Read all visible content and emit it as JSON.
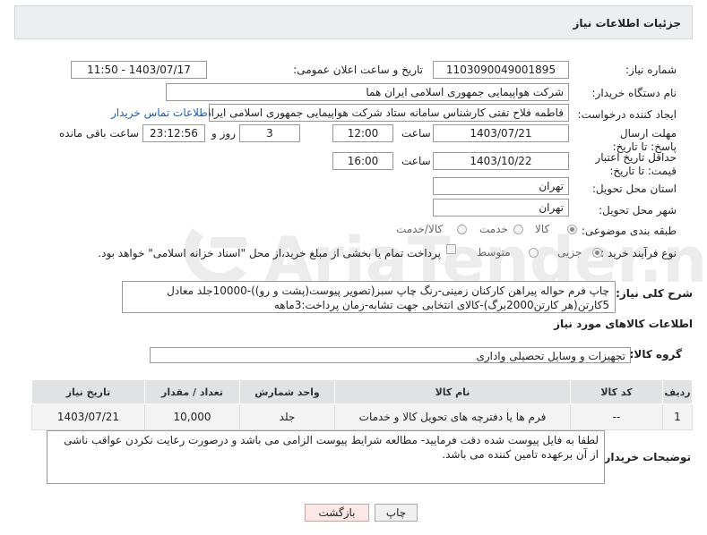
{
  "header": {
    "title": "جزئیات اطلاعات نیاز"
  },
  "form": {
    "need_number": {
      "label": "شماره نیاز:",
      "value": "1103090049001895"
    },
    "announce": {
      "label": "تاریخ و ساعت اعلان عمومی:",
      "value": "1403/07/17 - 11:50"
    },
    "buyer_org": {
      "label": "نام دستگاه خریدار:",
      "value": "شرکت هواپیمایی جمهوری اسلامی ایران هما"
    },
    "creator": {
      "label": "ایجاد کننده درخواست:",
      "value": "فاطمه فلاح تفتی کارشناس سامانه ستاد شرکت هواپیمایی جمهوری اسلامی ایران هما",
      "contact_link": "اطلاعات تماس خریدار"
    },
    "reply_deadline": {
      "label": "مهلت ارسال پاسخ: تا تاریخ:",
      "date": "1403/07/21",
      "time_label": "ساعت",
      "time": "12:00",
      "days": "3",
      "days_label": "روز و",
      "remaining": "23:12:56",
      "remaining_label": "ساعت باقی مانده"
    },
    "price_validity": {
      "label": "حداقل تاریخ اعتبار قیمت: تا تاریخ:",
      "date": "1403/10/22",
      "time_label": "ساعت",
      "time": "16:00"
    },
    "province": {
      "label": "استان محل تحویل:",
      "value": "تهران"
    },
    "city": {
      "label": "شهر محل تحویل:",
      "value": "تهران"
    },
    "category": {
      "label": "طبقه بندی موضوعی:",
      "options": [
        "کالا",
        "خدمت",
        "کالا/خدمت"
      ],
      "selected": 0
    },
    "process": {
      "label": "نوع فرآیند خرید :",
      "options": [
        "جزیی",
        "متوسط"
      ],
      "selected": 0,
      "note": "پرداخت تمام یا بخشی از مبلغ خرید،از محل \"اسناد خزانه اسلامی\" خواهد بود."
    }
  },
  "description": {
    "label": "شرح کلی نیاز:",
    "text": "چاپ فرم حواله پیراهن کارکنان زمینی-رنگ چاپ سبز(تصویر پیوست(پشت و رو))-10000جلد معادل 5کارتن(هر کارتن2000برگ)-کالای انتخابی جهت تشابه-زمان پرداخت:3ماهه"
  },
  "goods": {
    "title": "اطلاعات کالاهای مورد نیاز",
    "group_label": "گروه کالا:",
    "group_value": "تجهیزات و وسایل تحصیلی واداری",
    "columns": [
      "ردیف",
      "کد کالا",
      "نام کالا",
      "واحد شمارش",
      "تعداد / مقدار",
      "تاریخ نیاز"
    ],
    "rows": [
      {
        "row": "1",
        "code": "--",
        "name": "فرم ها یا دفترچه های تحویل کالا و خدمات",
        "unit": "جلد",
        "qty": "10,000",
        "date": "1403/07/21"
      }
    ]
  },
  "buyer_notes": {
    "label": "توضیحات خریدار:",
    "text": "لطفا به فایل پیوست شده دقت فرمایید- مطالعه شرایط پیوست الزامی می باشد و درصورت رعایت نکردن عواقب ناشی از آن برعهده تامین کننده می باشد."
  },
  "buttons": {
    "print": "چاپ",
    "back": "بازگشت"
  },
  "colors": {
    "back_button_bg": "#fde8e8",
    "link": "#1a5fb4",
    "header_bg": "#eceef0"
  }
}
